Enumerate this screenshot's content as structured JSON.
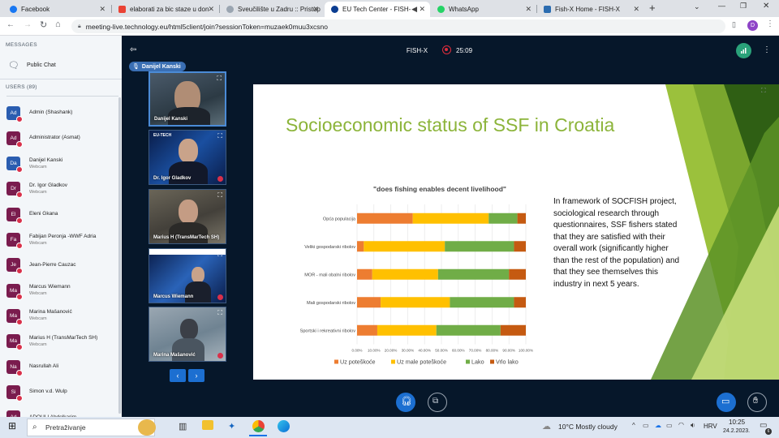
{
  "browser": {
    "tabs": [
      {
        "label": "Facebook",
        "color": "#1877f2"
      },
      {
        "label": "elaborati za bic staze u don",
        "color": "#ea4335"
      },
      {
        "label": "Sveučilište u Zadru :: Pristup",
        "color": "#9aa5b1"
      },
      {
        "label": "EU Tech Center - FISH-",
        "color": "#0b3d91"
      },
      {
        "label": "WhatsApp",
        "color": "#25d366"
      },
      {
        "label": "Fish-X Home - FISH-X",
        "color": "#2b6cb0"
      }
    ],
    "url": "meeting-live.technology.eu/html5client/join?sessionToken=muzaek0muu3xcsno",
    "profile_initial": "D"
  },
  "sidebar": {
    "messages_header": "MESSAGES",
    "public_chat": "Public Chat",
    "users_header": "USERS (89)",
    "users": [
      {
        "initials": "Ad",
        "name": "Admin (Shashank)",
        "sub": "",
        "blue": true
      },
      {
        "initials": "Ad",
        "name": "Administrator (Asmat)",
        "sub": "",
        "blue": false
      },
      {
        "initials": "Da",
        "name": "Danijel Kanski",
        "sub": "Webcam",
        "blue": true
      },
      {
        "initials": "Dr",
        "name": "Dr. Igor Gladkov",
        "sub": "Webcam",
        "blue": false
      },
      {
        "initials": "El",
        "name": "Eleni Gkana",
        "sub": "",
        "blue": false
      },
      {
        "initials": "Fa",
        "name": "Fabijan Peronja -WWF Adria",
        "sub": "Webcam",
        "blue": false
      },
      {
        "initials": "Je",
        "name": "Jean-Pierre Cauzac",
        "sub": "",
        "blue": false
      },
      {
        "initials": "Ma",
        "name": "Marcus Wiemann",
        "sub": "Webcam",
        "blue": false
      },
      {
        "initials": "Ma",
        "name": "Marina Mašanović",
        "sub": "Webcam",
        "blue": false
      },
      {
        "initials": "Ma",
        "name": "Marius H (TransMarTech SH)",
        "sub": "Webcam",
        "blue": false
      },
      {
        "initials": "Na",
        "name": "Nasrullah Ali",
        "sub": "",
        "blue": false
      },
      {
        "initials": "Si",
        "name": "Simon v.d. Wulp",
        "sub": "",
        "blue": false
      },
      {
        "initials": "Ad",
        "name": "ADOULI Abdelkarim",
        "sub": "",
        "blue": false
      }
    ]
  },
  "meeting": {
    "title": "FISH-X",
    "timer": "25:09",
    "presenter": "Danijel Kanski",
    "videos": [
      {
        "name": "Danijel Kanski"
      },
      {
        "name": "Dr. Igor Gladkov"
      },
      {
        "name": "Marius H (TransMarTech SH)"
      },
      {
        "name": "Marcus Wiemann"
      },
      {
        "name": "Marina Mašanović"
      }
    ],
    "video_logo": "EU-TECH"
  },
  "slide": {
    "title": "Socioeconomic status of SSF in Croatia",
    "text": "In framework of SOCFISH project, sociological research through questionnaires, SSF fishers stated that they are satisfied with their overall work (significantly higher than the rest of the population) and that they see themselves this industry in next 5 years."
  },
  "chart_data": {
    "type": "bar",
    "orientation": "horizontal",
    "stacked": true,
    "title": "\"does fishing enables decent livelihood\"",
    "categories": [
      "Opća populacija",
      "Veliki gospodarski ribolov",
      "MOR - mali obalni ribolov",
      "Mali gospodarski ribolov",
      "Sportski i rekreativni ribolov"
    ],
    "series": [
      {
        "name": "Uz poteškoće",
        "color": "#ed7d31",
        "values": [
          33,
          4,
          9,
          14,
          12
        ]
      },
      {
        "name": "Uz male poteškoće",
        "color": "#ffc000",
        "values": [
          45,
          48,
          39,
          41,
          35
        ]
      },
      {
        "name": "Lako",
        "color": "#70ad47",
        "values": [
          17,
          41,
          42,
          38,
          38
        ]
      },
      {
        "name": "Vrlo lako",
        "color": "#c55a11",
        "values": [
          5,
          7,
          10,
          7,
          15
        ]
      }
    ],
    "xticks": [
      "0.00%",
      "10.00%",
      "20.00%",
      "30.00%",
      "40.00%",
      "50.00%",
      "60.00%",
      "70.00%",
      "80.00%",
      "90.00%",
      "100.00%"
    ],
    "xlim": [
      0,
      100
    ],
    "legend": "bottom",
    "grid": true
  },
  "taskbar": {
    "search_placeholder": "Pretraživanje",
    "weather": "10°C  Mostly cloudy",
    "language": "HRV",
    "time": "10:25",
    "date": "24.2.2023.",
    "notif_count": "6"
  }
}
